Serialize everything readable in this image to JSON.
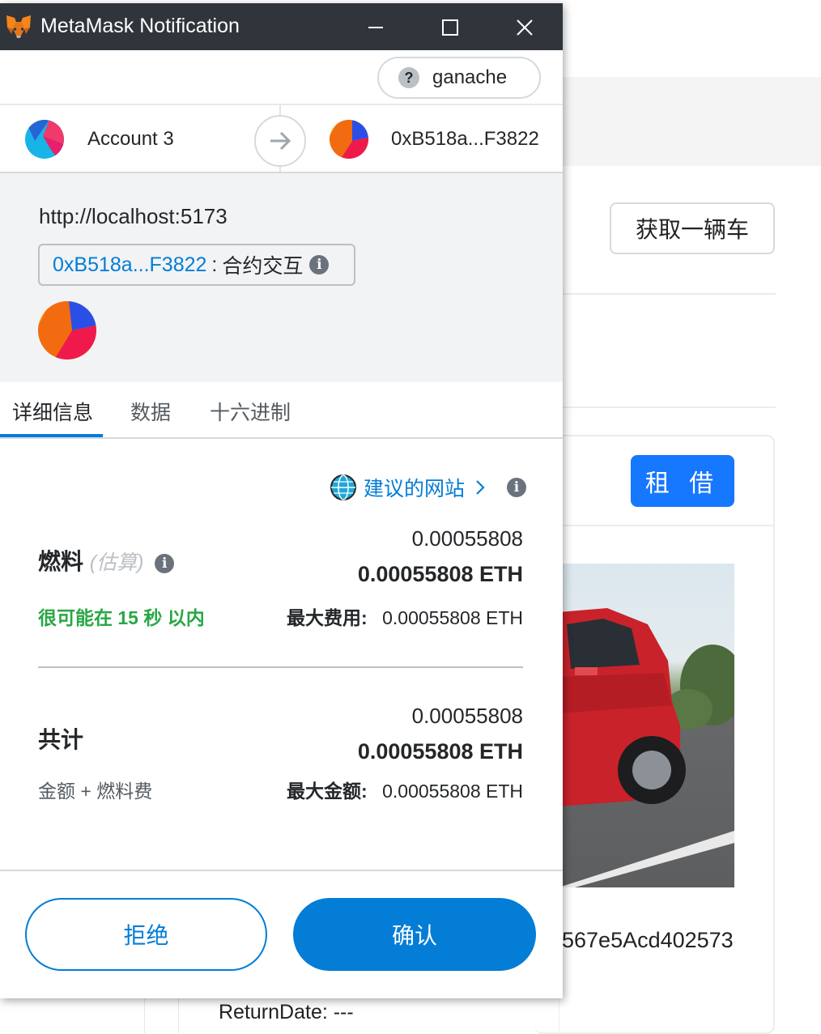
{
  "window": {
    "title": "MetaMask Notification",
    "titlebar_bg": "#2f353b"
  },
  "network": {
    "label": "ganache",
    "icon": "question-icon"
  },
  "accounts": {
    "from_name": "Account 3",
    "to_address": "0xB518a...F3822"
  },
  "origin": {
    "url": "http://localhost:5173",
    "contract_address": "0xB518a...F3822",
    "contract_separator": ":",
    "contract_action": "合约交互"
  },
  "tabs": [
    {
      "label": "详细信息",
      "active": true
    },
    {
      "label": "数据",
      "active": false
    },
    {
      "label": "十六进制",
      "active": false
    }
  ],
  "suggestion": {
    "label": "建议的网站"
  },
  "gas": {
    "label": "燃料",
    "estimate_label": "(估算)",
    "amount": "0.00055808",
    "amount_eth": "0.00055808 ETH",
    "speed": "很可能在 15 秒 以内",
    "max_fee_label": "最大费用:",
    "max_fee_value": "0.00055808 ETH"
  },
  "total": {
    "label": "共计",
    "sub_label": "金额 + 燃料费",
    "amount": "0.00055808",
    "amount_eth": "0.00055808 ETH",
    "max_amount_label": "最大金额:",
    "max_amount_value": "0.00055808 ETH"
  },
  "actions": {
    "reject": "拒绝",
    "confirm": "确认"
  },
  "background_app": {
    "get_car_button": "获取一辆车",
    "rent_button": "租 借",
    "address_tail": "567e5Acd402573",
    "return_date": "ReturnDate: ---"
  },
  "colors": {
    "accent": "#037dd6",
    "success": "#28a745",
    "rent_button": "#1677ff"
  }
}
